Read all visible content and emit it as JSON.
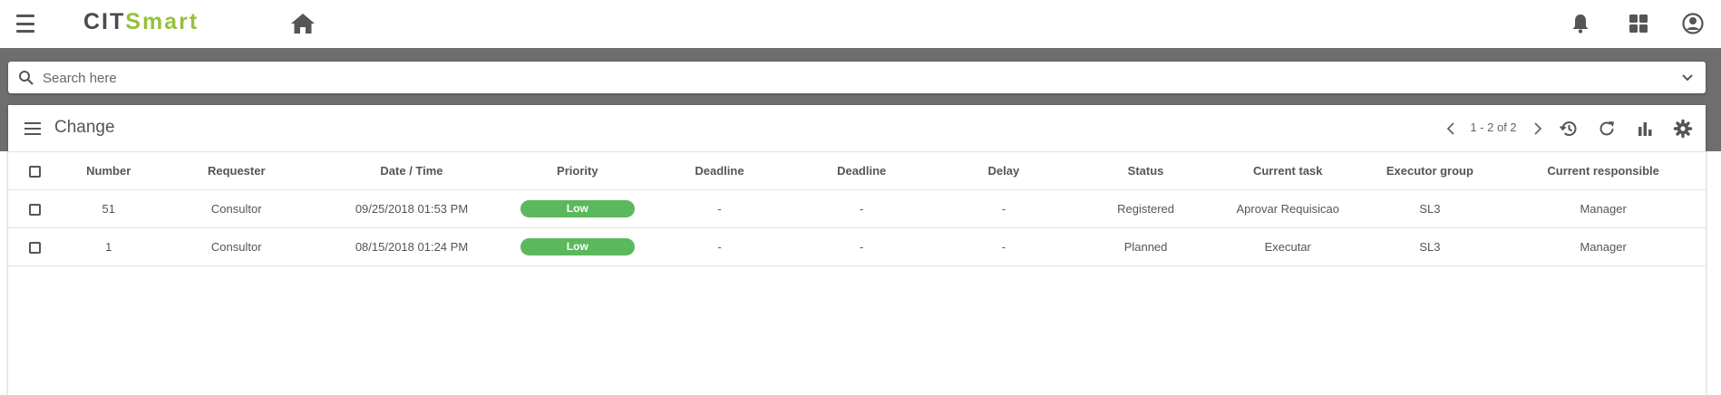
{
  "app": {
    "logo_part1": "CIT",
    "logo_part2": "Smart",
    "brand_color": "#96c03c",
    "accent_gray": "#6e6e6e"
  },
  "topbar": {
    "icons": [
      "menu-icon",
      "home-icon",
      "bell-icon",
      "apps-grid-icon",
      "user-account-icon"
    ]
  },
  "search": {
    "placeholder": "Search here",
    "value": ""
  },
  "panel": {
    "title": "Change",
    "pagination": "1 - 2 of 2",
    "header_icons": [
      "history-icon",
      "refresh-icon",
      "bar-chart-icon",
      "settings-icon"
    ]
  },
  "table": {
    "columns": [
      "Number",
      "Requester",
      "Date / Time",
      "Priority",
      "Deadline",
      "Deadline",
      "Delay",
      "Status",
      "Current task",
      "Executor group",
      "Current responsible"
    ],
    "rows": [
      {
        "number": "51",
        "requester": "Consultor",
        "datetime": "09/25/2018 01:53 PM",
        "priority": "Low",
        "deadline1": "-",
        "deadline2": "-",
        "delay": "-",
        "status": "Registered",
        "current_task": "Aprovar Requisicao",
        "executor_group": "SL3",
        "current_responsible": "Manager"
      },
      {
        "number": "1",
        "requester": "Consultor",
        "datetime": "08/15/2018 01:24 PM",
        "priority": "Low",
        "deadline1": "-",
        "deadline2": "-",
        "delay": "-",
        "status": "Planned",
        "current_task": "Executar",
        "executor_group": "SL3",
        "current_responsible": "Manager"
      }
    ],
    "priority_color": "#5cb85c"
  }
}
